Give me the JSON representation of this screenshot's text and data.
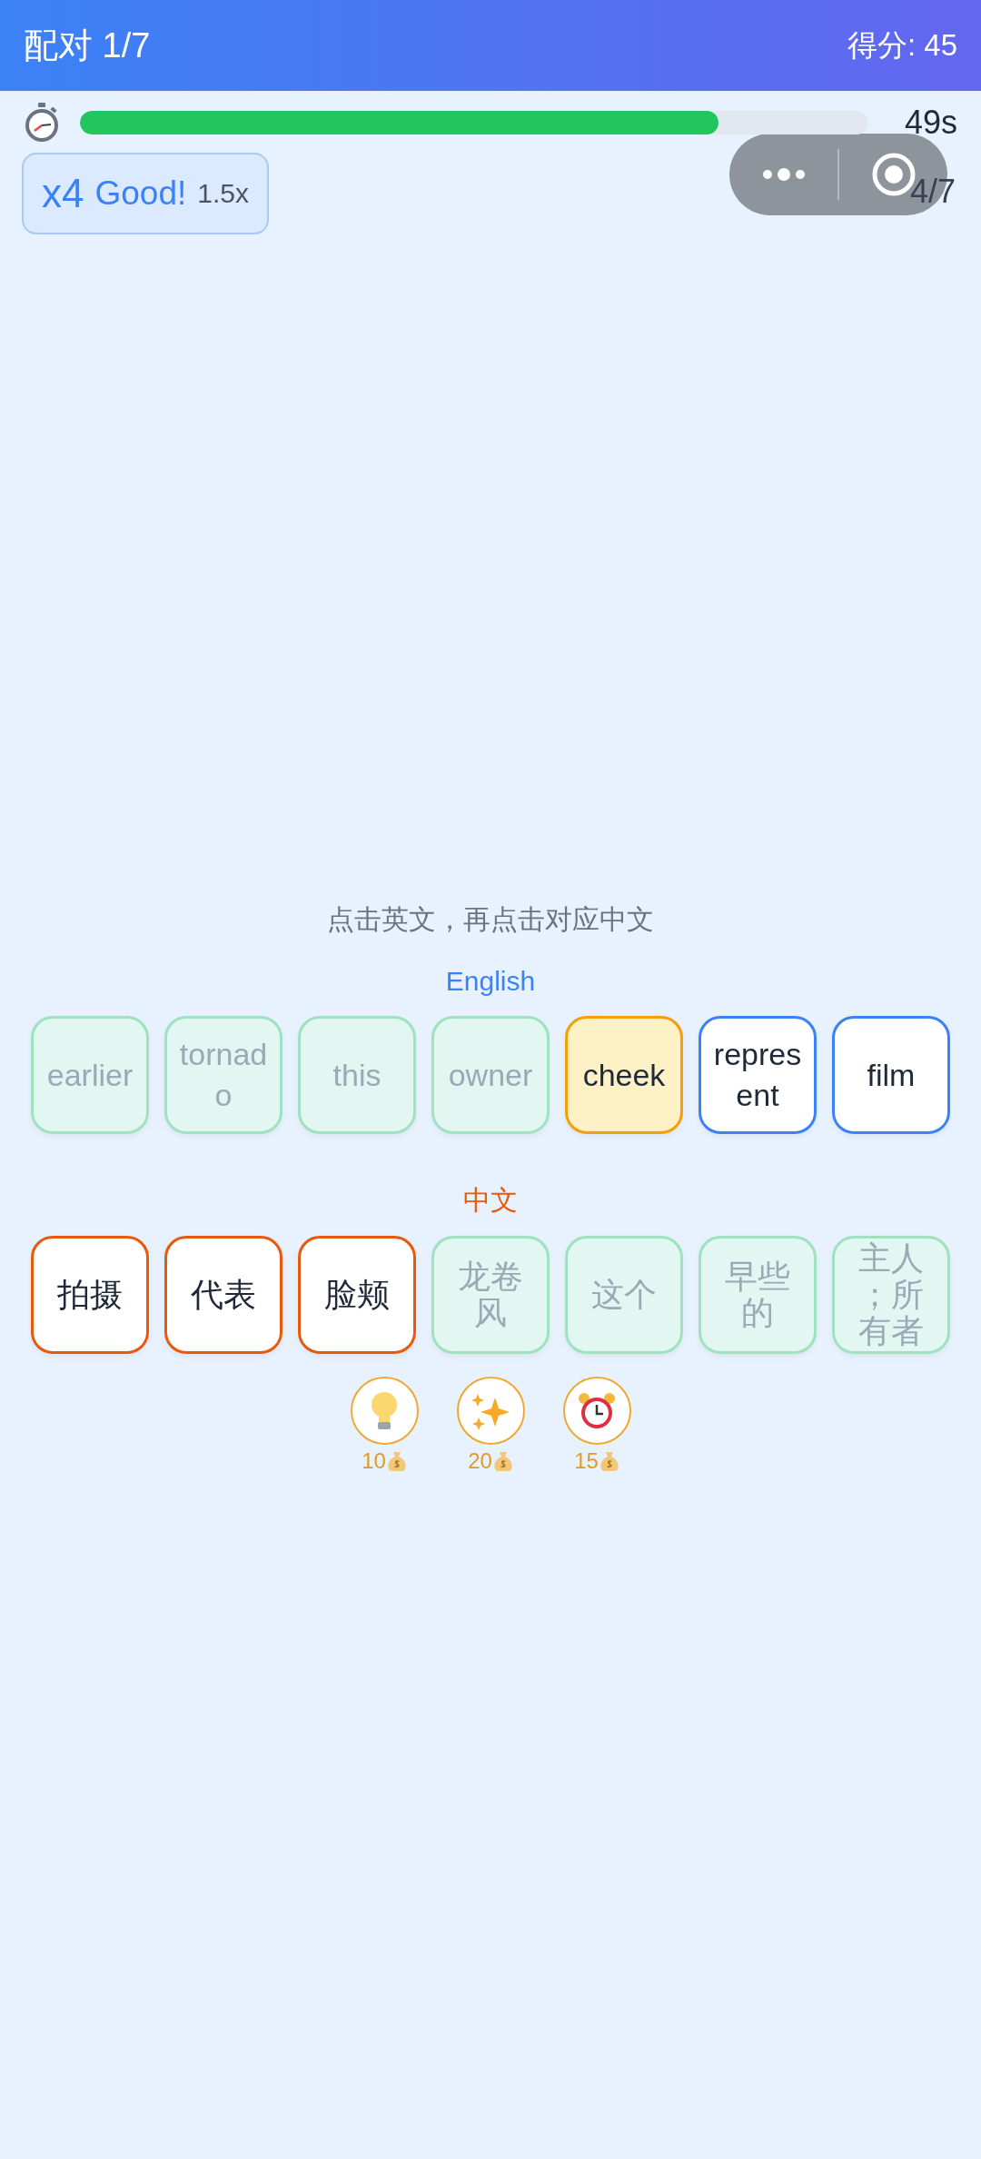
{
  "header": {
    "title": "配对 1/7",
    "score": "得分: 45"
  },
  "timer": {
    "level": 0.81,
    "remaining": "49s"
  },
  "combo": {
    "count": "x4",
    "rating": "Good!",
    "multiplier": "1.5x"
  },
  "progress": "4/7",
  "instruction": "点击英文，再点击对应中文",
  "groups": [
    {
      "kind": "english",
      "label": "English",
      "cards": [
        {
          "text": "earlier",
          "matched": true,
          "selected": false
        },
        {
          "text": "tornado",
          "matched": true,
          "selected": false
        },
        {
          "text": "this",
          "matched": true,
          "selected": false
        },
        {
          "text": "owner",
          "matched": true,
          "selected": false
        },
        {
          "text": "cheek",
          "matched": false,
          "selected": true
        },
        {
          "text": "represent",
          "matched": false,
          "selected": false
        },
        {
          "text": "film",
          "matched": false,
          "selected": false
        }
      ]
    },
    {
      "kind": "chinese",
      "label": "中文",
      "cards": [
        {
          "text": "拍摄",
          "matched": false,
          "selected": false
        },
        {
          "text": "代表",
          "matched": false,
          "selected": false
        },
        {
          "text": "脸颊",
          "matched": false,
          "selected": false
        },
        {
          "text": "龙卷风",
          "matched": true,
          "selected": false
        },
        {
          "text": "这个",
          "matched": true,
          "selected": false
        },
        {
          "text": "早些的",
          "matched": true,
          "selected": false
        },
        {
          "text": "主人；所有者",
          "matched": true,
          "selected": false
        }
      ]
    }
  ],
  "power_ups": [
    {
      "kind": "hint",
      "cost": "10"
    },
    {
      "kind": "sparkle",
      "cost": "20"
    },
    {
      "kind": "time",
      "cost": "15"
    }
  ]
}
